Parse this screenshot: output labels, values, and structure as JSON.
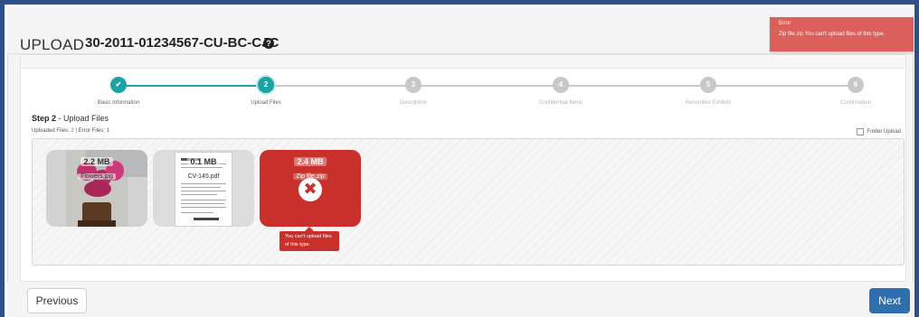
{
  "header": {
    "title": "UPLOAD",
    "case_number": "30-2011-01234567-CU-BC-CJC",
    "help_glyph": "?"
  },
  "stepper": {
    "steps": [
      {
        "label": "Basic Information",
        "marker": "✔",
        "state": "done"
      },
      {
        "label": "Upload Files",
        "marker": "2",
        "state": "active"
      },
      {
        "label": "Description",
        "marker": "3",
        "state": "pending"
      },
      {
        "label": "Confidential Items",
        "marker": "4",
        "state": "pending"
      },
      {
        "label": "Renumber Exhibits",
        "marker": "5",
        "state": "pending"
      },
      {
        "label": "Confirmation",
        "marker": "6",
        "state": "pending"
      }
    ]
  },
  "step_heading": {
    "prefix": "Step 2",
    "suffix": " - Upload Files"
  },
  "file_stats": {
    "uploaded_label": "Uploaded Files: ",
    "uploaded_count": "2",
    "error_text": " | Error Files: 1"
  },
  "folder_upload": {
    "label": "Folder Upload",
    "checked": false
  },
  "files": [
    {
      "size": "2.2 MB",
      "name": "Flowers.jpg",
      "status": "ok"
    },
    {
      "size": "0.1 MB",
      "name": "CV-145.pdf",
      "status": "ok"
    },
    {
      "size": "2.4 MB",
      "name": "Zip file.zip",
      "status": "error",
      "error_glyph": "✖",
      "error_message": "You can't upload files of this type."
    }
  ],
  "footer": {
    "previous_label": "Previous",
    "next_label": "Next"
  },
  "toast": {
    "title": "Error",
    "message": "Zip file.zip You can't upload files of this type."
  },
  "colors": {
    "frame_border": "#2f4f86",
    "accent_teal": "#1aa3a3",
    "error_red": "#c9302c",
    "toast_red": "#d9534f",
    "next_button": "#2f6fb0"
  }
}
